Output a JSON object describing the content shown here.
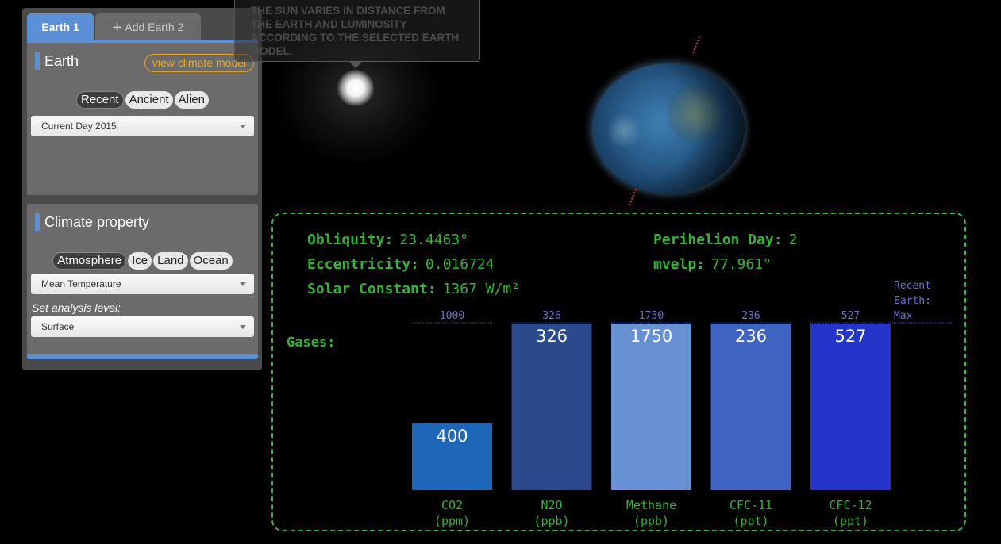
{
  "tabs": {
    "earth1": "Earth 1",
    "add_earth": "Add Earth 2"
  },
  "earth_card": {
    "title": "Earth",
    "view_model": "view climate model",
    "modes": [
      "Recent",
      "Ancient",
      "Alien"
    ],
    "active_mode": "Recent",
    "selected_period": "Current Day 2015"
  },
  "climate_card": {
    "title": "Climate property",
    "modes": [
      "Atmosphere",
      "Ice",
      "Land",
      "Ocean"
    ],
    "active_mode": "Atmosphere",
    "selected_property": "Mean Temperature",
    "analysis_label": "Set analysis level:",
    "selected_level": "Surface"
  },
  "tooltip": {
    "text": "THE SUN VARIES IN DISTANCE FROM THE EARTH AND LUMINOSITY ACCORDING TO THE SELECTED EARTH MODEL."
  },
  "orbit": {
    "obliquity_label": "Obliquity:",
    "obliquity_value": "23.4463°",
    "eccentricity_label": "Eccentricity:",
    "eccentricity_value": "0.016724",
    "solar_label": "Solar Constant:",
    "solar_value": "1367 W/m²",
    "perihelion_label": "Perihelion Day:",
    "perihelion_value": "2",
    "mvelp_label": "mvelp:",
    "mvelp_value": "77.961°"
  },
  "gases_label": "Gases:",
  "legend_lines": [
    "Recent",
    "Earth:",
    "Max"
  ],
  "chart_data": {
    "type": "bar",
    "categories": [
      "CO2",
      "N2O",
      "Methane",
      "CFC-11",
      "CFC-12"
    ],
    "units": [
      "(ppm)",
      "(ppb)",
      "(ppb)",
      "(ppt)",
      "(ppt)"
    ],
    "values": [
      400,
      326,
      1750,
      236,
      527
    ],
    "max_values": [
      1000,
      326,
      1750,
      236,
      527
    ],
    "colors": [
      "#1d66b8",
      "#2b4a8c",
      "#6891d4",
      "#3e63c0",
      "#2535c9"
    ]
  },
  "colors": {
    "accent": "#5b8fd6",
    "green": "#35b335",
    "orange": "#f0a820"
  }
}
